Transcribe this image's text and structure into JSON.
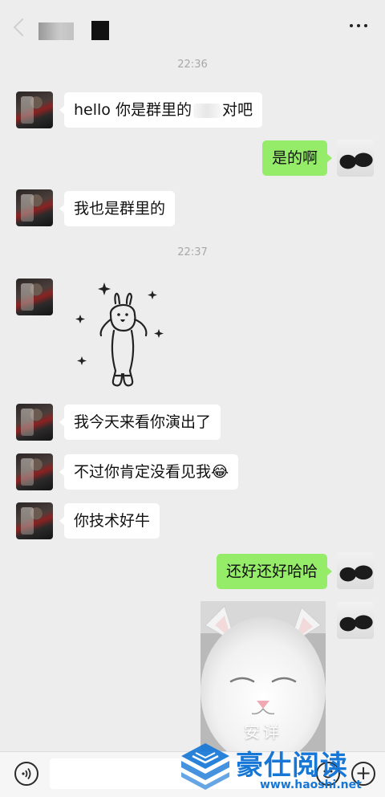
{
  "header": {
    "title_redacted": true
  },
  "messages": {
    "time_1": "22:36",
    "time_2": "22:37",
    "msg_1": "hello 你是群里的",
    "msg_1_tail": "对吧",
    "msg_2": "是的啊",
    "msg_3": "我也是群里的",
    "msg_4": "我今天来看你演出了",
    "msg_5": "不过你肯定没看见我😂",
    "msg_6": "你技术好牛",
    "msg_7": "还好还好哈哈"
  },
  "cat_image": {
    "caption": "安详"
  },
  "input_bar": {
    "placeholder": "",
    "plus_glyph": "+"
  },
  "watermark": {
    "title": "豪仕阅读",
    "url": "www.haoshi.net"
  },
  "colors": {
    "background": "#ededed",
    "bubble_left": "#ffffff",
    "bubble_right": "#95ec69",
    "watermark": "#1677d6"
  },
  "icons": [
    "back-icon",
    "more-icon",
    "voice-icon",
    "emoji-icon",
    "plus-icon",
    "sparkle-icon"
  ]
}
